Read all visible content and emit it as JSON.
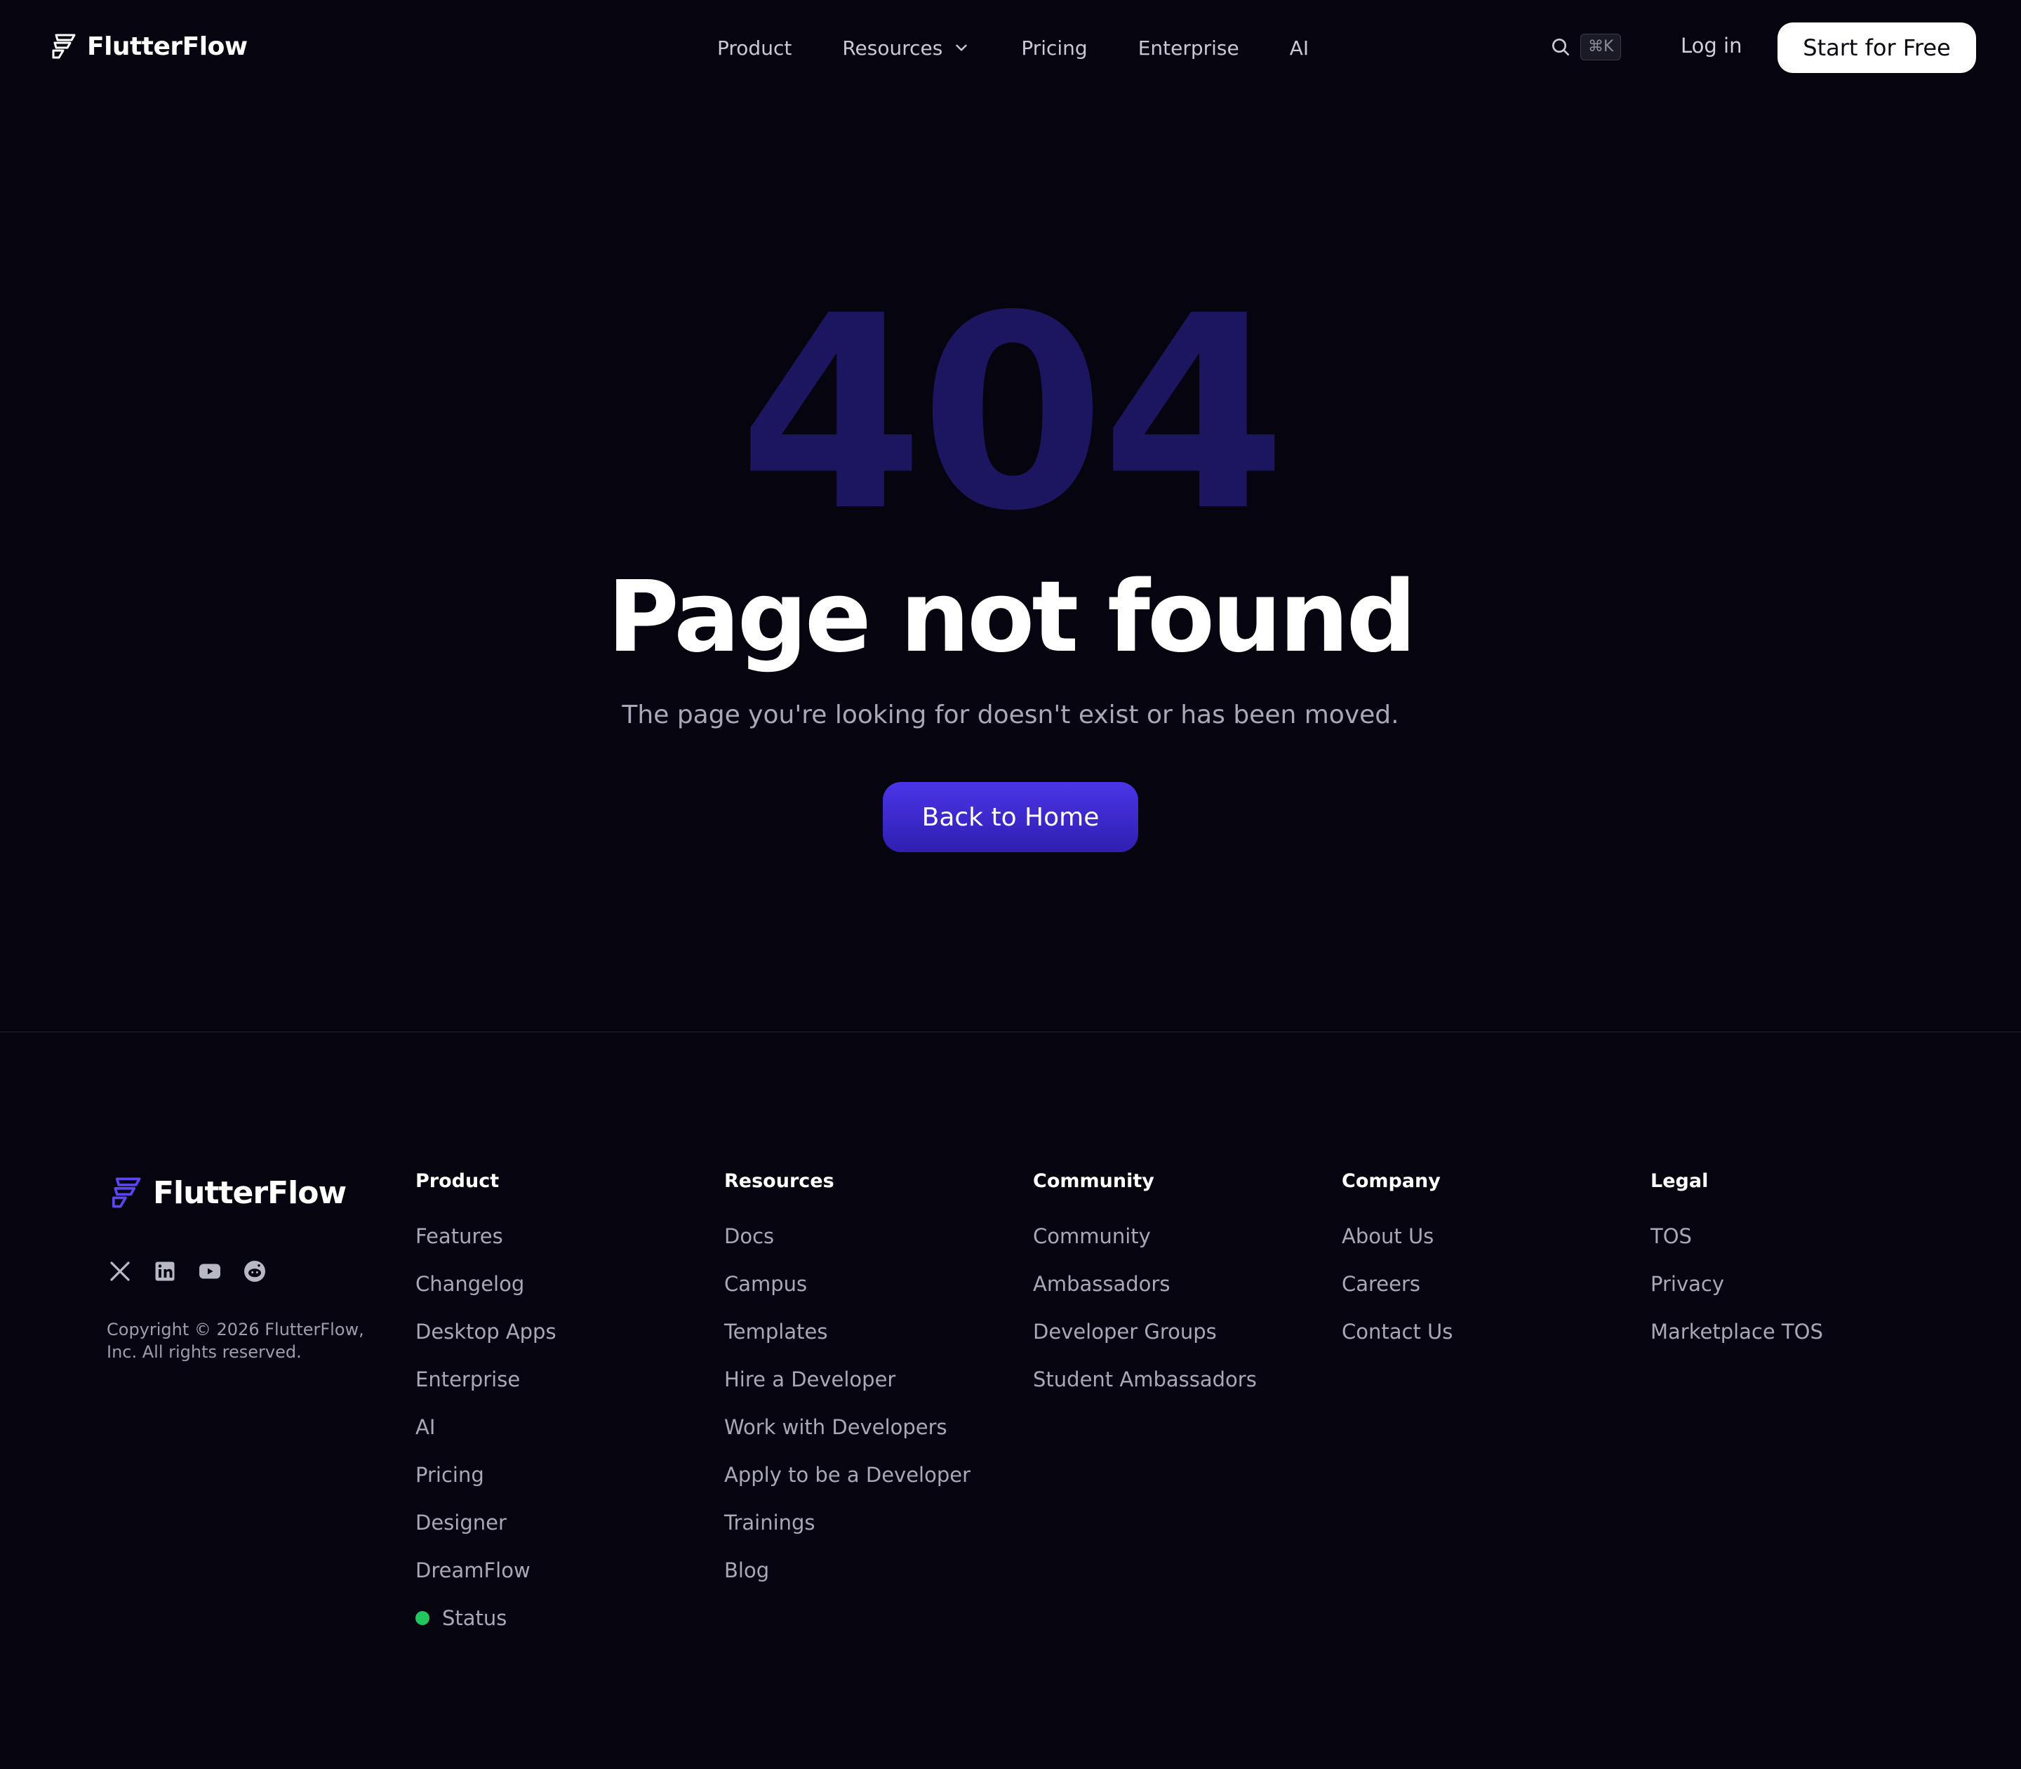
{
  "brand": {
    "name": "FlutterFlow",
    "accent": "#4a35e8",
    "status_color": "#22c55e"
  },
  "nav": {
    "links": [
      "Product",
      "Resources",
      "Pricing",
      "Enterprise",
      "AI"
    ],
    "search_shortcut": "⌘K",
    "login_label": "Log in",
    "cta_label": "Start for Free"
  },
  "hero": {
    "code": "404",
    "title": "Page not found",
    "subtitle": "The page you're looking for doesn't exist or has been moved.",
    "button_label": "Back to Home"
  },
  "footer": {
    "socials": [
      "x-icon",
      "linkedin-icon",
      "youtube-icon",
      "reddit-icon"
    ],
    "copyright": "Copyright © 2026 FlutterFlow, Inc. All rights reserved.",
    "columns": [
      {
        "title": "Product",
        "items": [
          "Features",
          "Changelog",
          "Desktop Apps",
          "Enterprise",
          "AI",
          "Pricing",
          "Designer",
          "DreamFlow",
          "Status"
        ]
      },
      {
        "title": "Resources",
        "items": [
          "Docs",
          "Campus",
          "Templates",
          "Hire a Developer",
          "Work with Developers",
          "Apply to be a Developer",
          "Trainings",
          "Blog"
        ]
      },
      {
        "title": "Community",
        "items": [
          "Community",
          "Ambassadors",
          "Developer Groups",
          "Student Ambassadors"
        ]
      },
      {
        "title": "Company",
        "items": [
          "About Us",
          "Careers",
          "Contact Us"
        ]
      },
      {
        "title": "Legal",
        "items": [
          "TOS",
          "Privacy",
          "Marketplace TOS"
        ]
      }
    ]
  }
}
